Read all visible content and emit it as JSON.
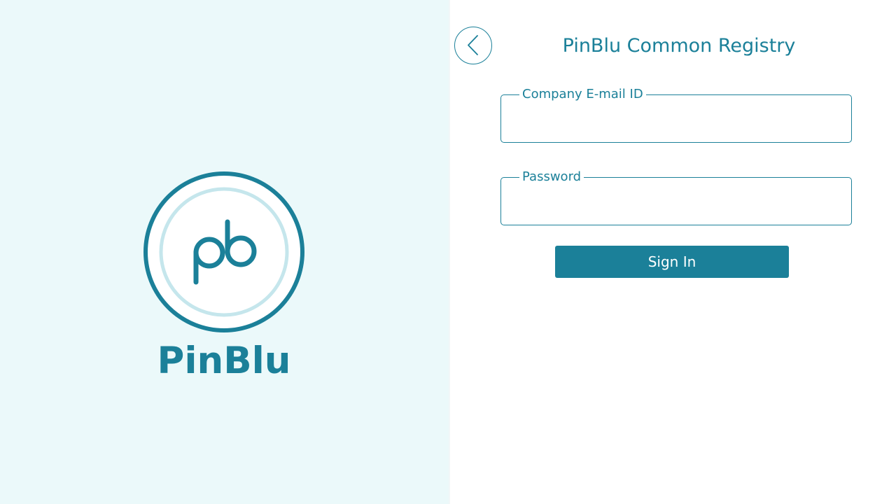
{
  "brand": {
    "name": "PinBlu",
    "logo_monogram": "pb",
    "primary_color": "#1b8099",
    "light_ring_color": "#c5e6ec",
    "panel_background": "#ebf9fa"
  },
  "header": {
    "back_icon": "chevron-left-icon",
    "title": "PinBlu Common Registry"
  },
  "form": {
    "email": {
      "label": "Company E-mail ID",
      "value": "",
      "placeholder": ""
    },
    "password": {
      "label": "Password",
      "value": "",
      "placeholder": ""
    },
    "submit_label": "Sign In"
  }
}
